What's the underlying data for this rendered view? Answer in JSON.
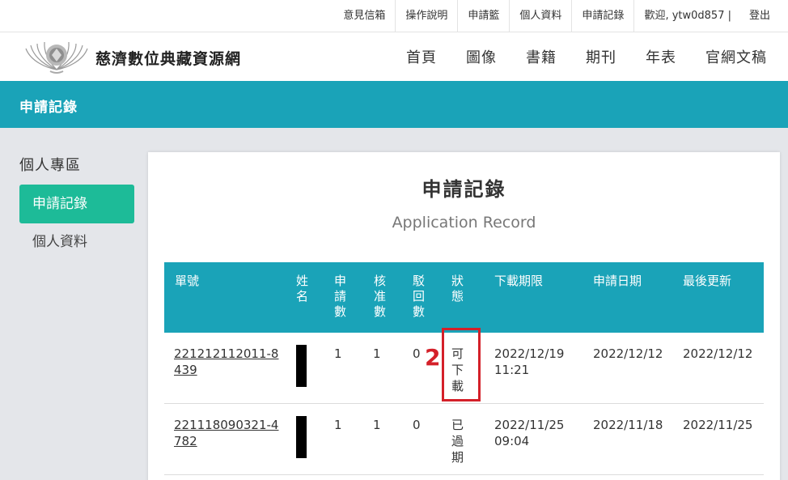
{
  "topbar": {
    "items": [
      "意見信箱",
      "操作說明",
      "申請籃",
      "個人資料",
      "申請記錄"
    ],
    "welcome": "歡迎, ytw0d857 |",
    "logout": "登出"
  },
  "header": {
    "site_name": "慈濟數位典藏資源網",
    "nav": [
      "首頁",
      "圖像",
      "書籍",
      "期刊",
      "年表",
      "官網文稿"
    ]
  },
  "banner": {
    "title": "申請記錄"
  },
  "sidebar": {
    "heading": "個人專區",
    "items": [
      "申請記錄",
      "個人資料"
    ]
  },
  "main": {
    "title": "申請記錄",
    "subtitle": "Application Record",
    "table": {
      "headers": [
        "單號",
        "姓名",
        "申請數",
        "核准數",
        "駁回數",
        "狀態",
        "下載期限",
        "申請日期",
        "最後更新"
      ],
      "rows": [
        {
          "order_no": "221212112011-8439",
          "applied": "1",
          "approved": "1",
          "rejected": "0",
          "status": "可下載",
          "deadline": "2022/12/19 11:21",
          "apply_date": "2022/12/12",
          "updated": "2022/12/12"
        },
        {
          "order_no": "221118090321-4782",
          "applied": "1",
          "approved": "1",
          "rejected": "0",
          "status": "已過期",
          "deadline": "2022/11/25 09:04",
          "apply_date": "2022/11/18",
          "updated": "2022/11/25"
        }
      ]
    },
    "annotation": "2"
  },
  "colors": {
    "teal": "#1aa3b8",
    "green": "#1dbb98",
    "annotation_red": "#d42029"
  }
}
